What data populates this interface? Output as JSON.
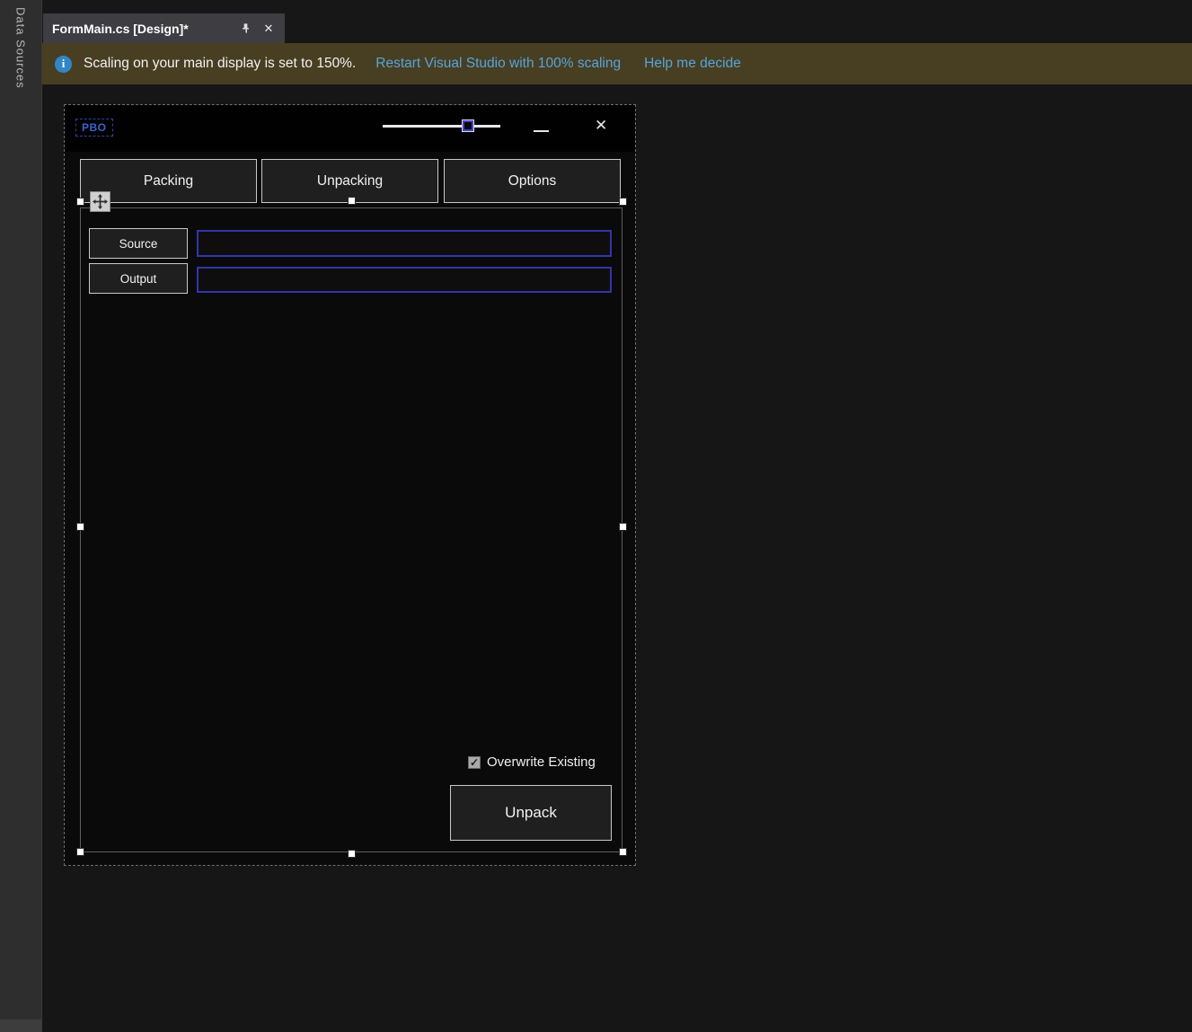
{
  "sidebar": {
    "label": "Data Sources"
  },
  "doc_tab": {
    "title": "FormMain.cs [Design]*"
  },
  "info_bar": {
    "message": "Scaling on your main display is set to 150%.",
    "links": [
      {
        "label": "Restart Visual Studio with 100% scaling"
      },
      {
        "label": "Help me decide"
      }
    ]
  },
  "form_designer": {
    "window": {
      "title": "PBO"
    },
    "tab_buttons": [
      {
        "label": "Packing"
      },
      {
        "label": "Unpacking"
      },
      {
        "label": "Options"
      }
    ],
    "fields": [
      {
        "label": "Source",
        "value": ""
      },
      {
        "label": "Output",
        "value": ""
      }
    ],
    "checkbox": {
      "label": "Overwrite Existing",
      "checked": true
    },
    "unpack_button": {
      "label": "Unpack"
    }
  },
  "icons": {
    "close": "✕",
    "check": "✓",
    "info": "i"
  },
  "colors": {
    "accent_blue": "#3c63cc",
    "link_blue": "#56a4dd",
    "infobar_bg": "#483e21",
    "textbox_border": "#3434ad",
    "selection_handle": "#ffffff"
  }
}
